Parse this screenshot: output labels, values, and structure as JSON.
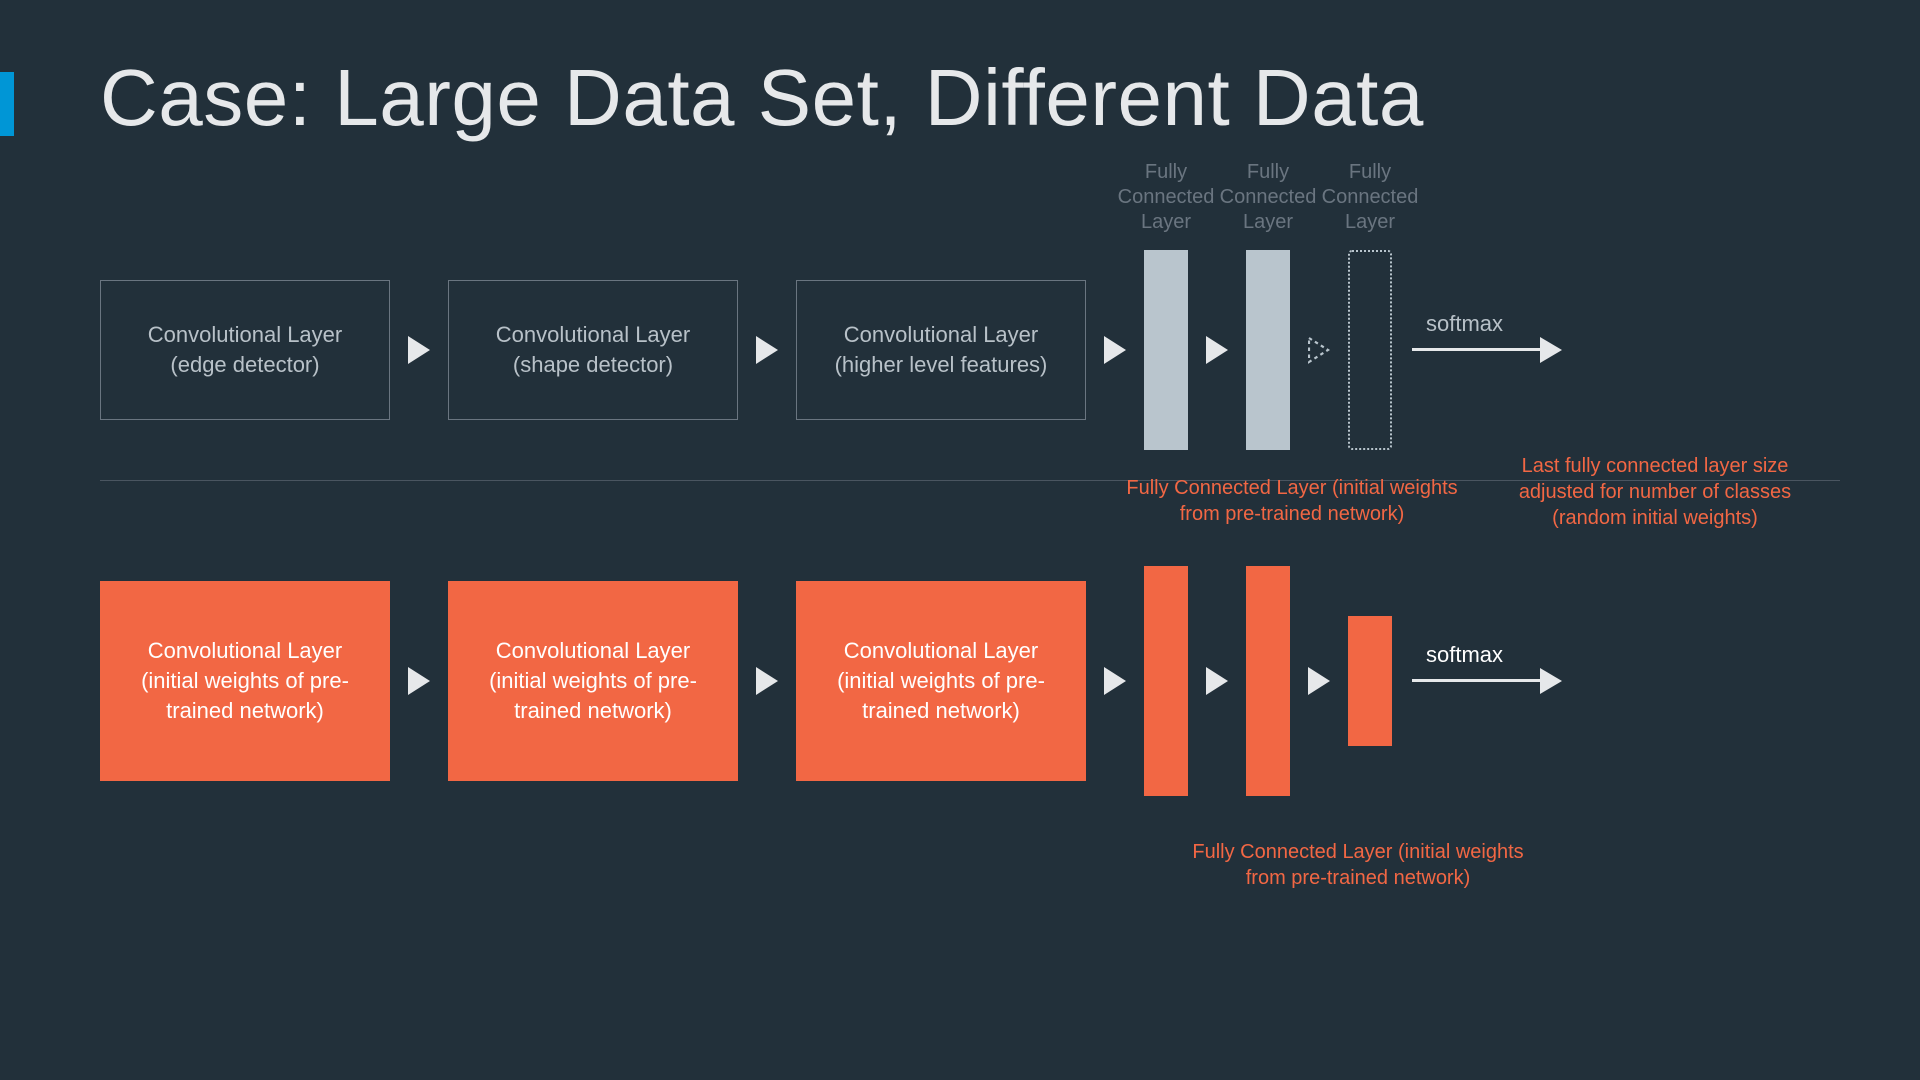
{
  "title": "Case: Large Data Set, Different Data",
  "row1": {
    "conv1": "Convolutional Layer (edge detector)",
    "conv2": "Convolutional Layer (shape detector)",
    "conv3": "Convolutional Layer (higher level features)",
    "fc1": "Fully Connected Layer",
    "fc2": "Fully Connected Layer",
    "fc3": "Fully Connected Layer",
    "softmax": "softmax"
  },
  "row2": {
    "conv1": "Convolutional Layer (initial weights of pre-trained network)",
    "conv2": "Convolutional Layer (initial weights of pre-trained network)",
    "conv3": "Convolutional Layer (initial weights of pre-trained network)",
    "fc1_label": "Fully Connected Layer (initial weights from pre-trained network)",
    "fc2_label": "Fully Connected Layer (initial weights from pre-trained network)",
    "fc3_label": "Last fully connected layer size adjusted for number of classes (random initial weights)",
    "softmax": "softmax"
  }
}
